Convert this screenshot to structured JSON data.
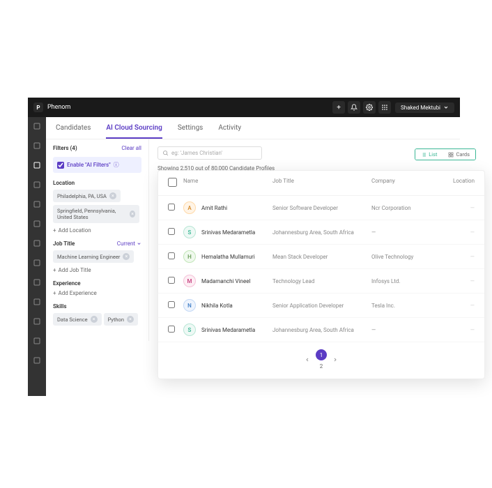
{
  "brand": {
    "name": "Phenom",
    "icon": "P"
  },
  "user": {
    "name": "Shaked Mektubi"
  },
  "tabs": [
    "Candidates",
    "AI Cloud Sourcing",
    "Settings",
    "Activity"
  ],
  "activeTab": 1,
  "filters": {
    "title": "Filters (4)",
    "clear": "Clear all",
    "aiToggle": "Enable \"AI Filters\"",
    "location": {
      "label": "Location",
      "chips": [
        "Philadelphia, PA, USA",
        "Springfield, Pennsylvania, United States"
      ],
      "add": "Add Location"
    },
    "jobTitle": {
      "label": "Job Title",
      "sub": "Current",
      "chips": [
        "Machine Learning Engineer"
      ],
      "add": "Add Job Title"
    },
    "experience": {
      "label": "Experience",
      "add": "Add Experience"
    },
    "skills": {
      "label": "Skills",
      "chips": [
        "Data Science",
        "Python"
      ]
    }
  },
  "search": {
    "placeholder": "eg: 'James Christian'"
  },
  "viewToggle": {
    "list": "List",
    "cards": "Cards"
  },
  "resultCount": "Showing 2,510 out of 80,000 Candidate Profiles",
  "columns": {
    "name": "Name",
    "job": "Job Title",
    "company": "Company",
    "location": "Location"
  },
  "rows": [
    {
      "initial": "A",
      "avatarClass": "av-a",
      "name": "Amit Rathi",
      "job": "Senior Software Developer",
      "company": "Ncr Corporation",
      "location": "—"
    },
    {
      "initial": "S",
      "avatarClass": "av-s",
      "name": "Srinivas Medarametla",
      "job": "Johannesburg Area, South Africa",
      "company": "—",
      "location": "—"
    },
    {
      "initial": "H",
      "avatarClass": "av-h",
      "name": "Hemalatha Mullamuri",
      "job": "Mean Stack Developer",
      "company": "Olive Technology",
      "location": "—"
    },
    {
      "initial": "M",
      "avatarClass": "av-m",
      "name": "Madamanchi Vineel",
      "job": "Technology Lead",
      "company": "Infosys Ltd.",
      "location": "—"
    },
    {
      "initial": "N",
      "avatarClass": "av-n",
      "name": "Nikhila Kotla",
      "job": "Senior Application Developer",
      "company": "Tesla Inc.",
      "location": "—"
    },
    {
      "initial": "S",
      "avatarClass": "av-s",
      "name": "Srinivas Medarametla",
      "job": "Johannesburg Area, South Africa",
      "company": "—",
      "location": "—"
    }
  ],
  "pager": {
    "pages": [
      "1",
      "2"
    ],
    "active": 0
  }
}
